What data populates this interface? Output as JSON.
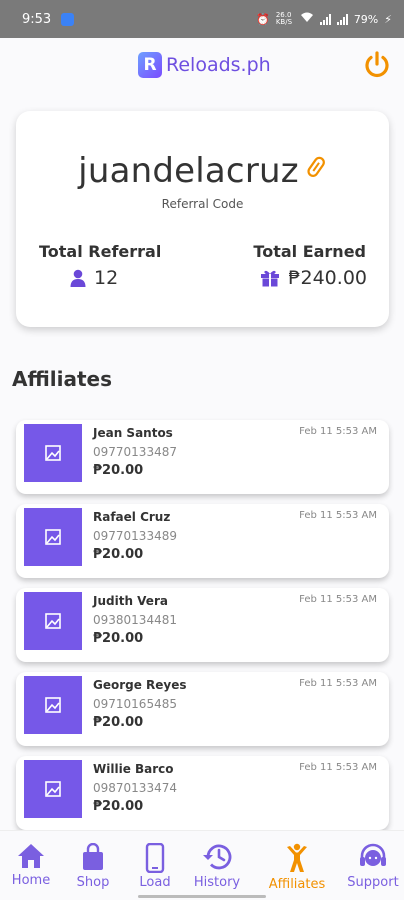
{
  "status_bar": {
    "time": "9:53",
    "data_speed": "26.0 KB/S",
    "battery": "79%"
  },
  "brand": {
    "logo_letter": "R",
    "name": "Reloads.ph"
  },
  "referral": {
    "code": "juandelacruz",
    "caption": "Referral Code",
    "total_referral_label": "Total Referral",
    "total_referral_value": "12",
    "total_earned_label": "Total Earned",
    "total_earned_value": "₱240.00"
  },
  "affiliates_title": "Affiliates",
  "affiliates": [
    {
      "name": "Jean Santos",
      "phone": "09770133487",
      "amount": "₱20.00",
      "date": "Feb 11 5:53 AM"
    },
    {
      "name": "Rafael Cruz",
      "phone": "09770133489",
      "amount": "₱20.00",
      "date": "Feb 11 5:53 AM"
    },
    {
      "name": "Judith Vera",
      "phone": "09380134481",
      "amount": "₱20.00",
      "date": "Feb 11 5:53 AM"
    },
    {
      "name": "George Reyes",
      "phone": "09710165485",
      "amount": "₱20.00",
      "date": "Feb 11 5:53 AM"
    },
    {
      "name": "Willie Barco",
      "phone": "09870133474",
      "amount": "₱20.00",
      "date": "Feb 11 5:53 AM"
    }
  ],
  "nav": [
    {
      "label": "Home",
      "icon": "home-icon"
    },
    {
      "label": "Shop",
      "icon": "shopping-bag-icon"
    },
    {
      "label": "Load",
      "icon": "phone-icon"
    },
    {
      "label": "History",
      "icon": "history-icon"
    },
    {
      "label": "Affiliates",
      "icon": "affiliates-icon",
      "active": true
    },
    {
      "label": "Support",
      "icon": "support-icon"
    }
  ],
  "colors": {
    "accent": "#7658e8",
    "active": "#f29100",
    "power": "#f29100"
  }
}
